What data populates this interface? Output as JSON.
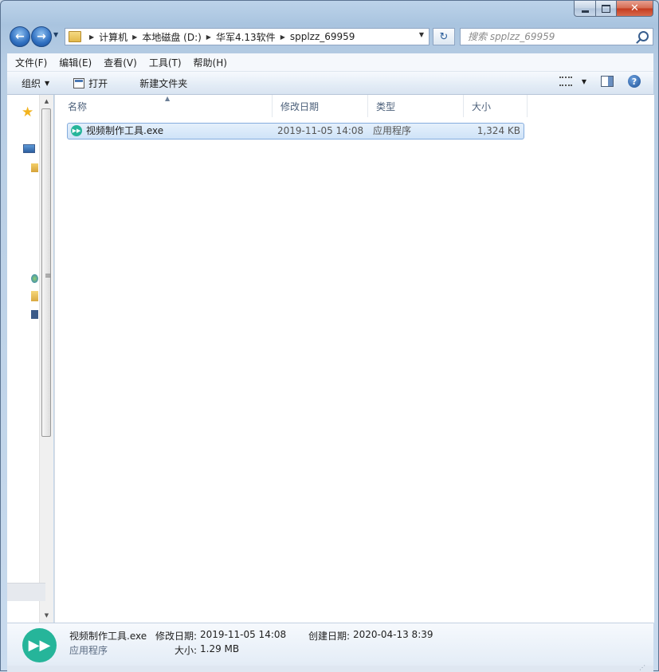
{
  "window": {
    "min_symbol": "",
    "max_symbol": "",
    "close_symbol": "✕"
  },
  "nav": {
    "back_symbol": "←",
    "forward_symbol": "→",
    "breadcrumbs": [
      "计算机",
      "本地磁盘 (D:)",
      "华军4.13软件",
      "spplzz_69959"
    ],
    "search_placeholder": "搜索 spplzz_69959"
  },
  "menu": {
    "items": [
      "文件(F)",
      "编辑(E)",
      "查看(V)",
      "工具(T)",
      "帮助(H)"
    ]
  },
  "toolbar": {
    "organize": "组织",
    "open": "打开",
    "new_folder": "新建文件夹",
    "help_symbol": "?"
  },
  "columns": {
    "name": "名称",
    "modified": "修改日期",
    "type": "类型",
    "size": "大小"
  },
  "files": [
    {
      "name": "视频制作工具.exe",
      "modified": "2019-11-05 14:08",
      "type": "应用程序",
      "size": "1,324 KB"
    }
  ],
  "details": {
    "name": "视频制作工具.exe",
    "type": "应用程序",
    "modified_label": "修改日期:",
    "modified_value": "2019-11-05 14:08",
    "created_label": "创建日期:",
    "created_value": "2020-04-13 8:39",
    "size_label": "大小:",
    "size_value": "1.29 MB"
  },
  "colors": {
    "app_icon": "#26b59a",
    "selection": "#cfe3f8",
    "accent": "#2f6fc0"
  }
}
